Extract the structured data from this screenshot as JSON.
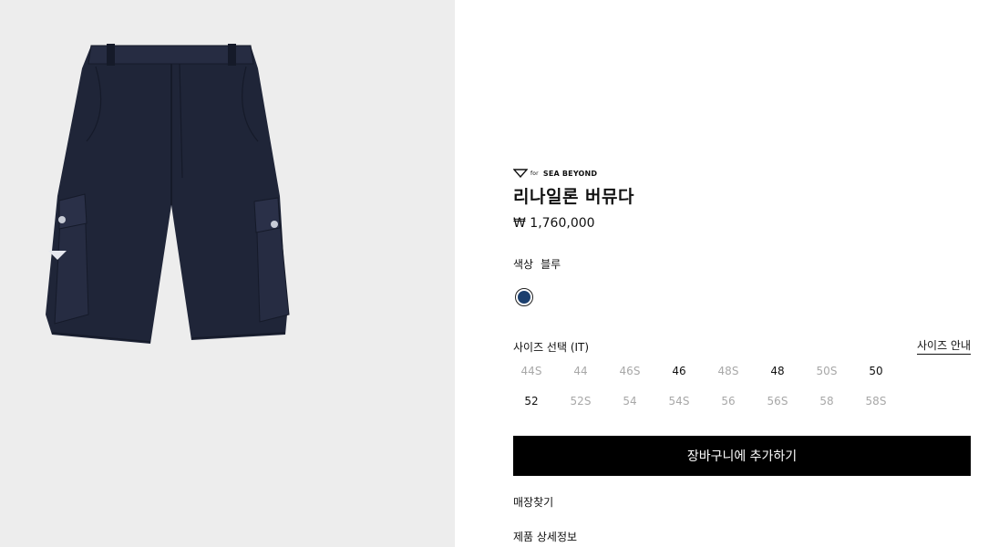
{
  "product": {
    "brand_prefix": "for",
    "brand": "SEA BEYOND",
    "name": "리나일론 버뮤다",
    "price": "₩ 1,760,000"
  },
  "color": {
    "label": "색상",
    "value": "블루",
    "swatch_hex": "#1c3f6e"
  },
  "size": {
    "label": "사이즈 선택 (IT)",
    "guide_label": "사이즈 안내",
    "options": [
      {
        "label": "44S",
        "available": false
      },
      {
        "label": "44",
        "available": false
      },
      {
        "label": "46S",
        "available": false
      },
      {
        "label": "46",
        "available": true
      },
      {
        "label": "48S",
        "available": false
      },
      {
        "label": "48",
        "available": true
      },
      {
        "label": "50S",
        "available": false
      },
      {
        "label": "50",
        "available": true
      },
      {
        "label": "52",
        "available": true
      },
      {
        "label": "52S",
        "available": false
      },
      {
        "label": "54",
        "available": false
      },
      {
        "label": "54S",
        "available": false
      },
      {
        "label": "56",
        "available": false
      },
      {
        "label": "56S",
        "available": false
      },
      {
        "label": "58",
        "available": false
      },
      {
        "label": "58S",
        "available": false
      }
    ]
  },
  "actions": {
    "add_to_cart": "장바구니에 추가하기",
    "find_store": "매장찾기",
    "product_details": "제품 상세정보"
  },
  "colors": {
    "gallery_bg": "#ededed",
    "button_bg": "#000000",
    "unavailable_text": "#a8a8a8",
    "shorts_navy": "#1f2538"
  }
}
